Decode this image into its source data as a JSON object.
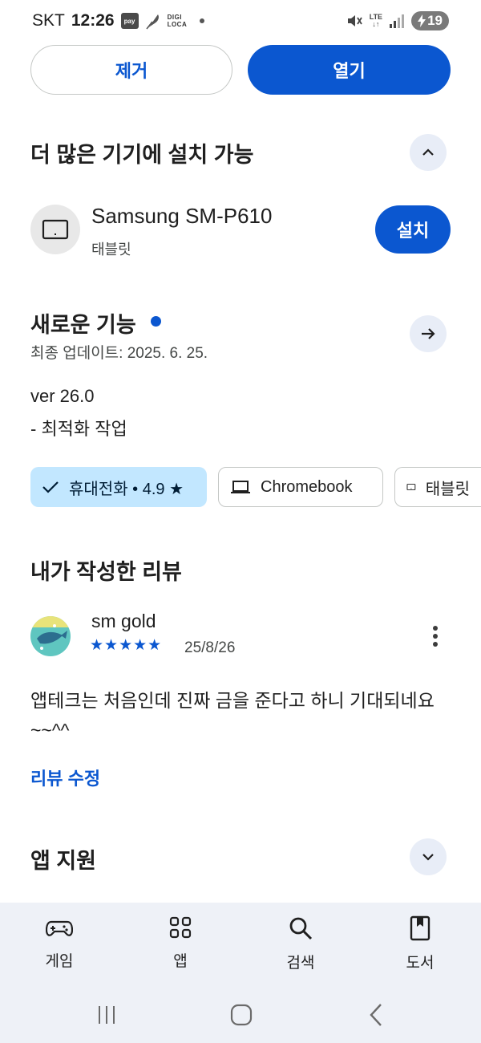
{
  "status_bar": {
    "carrier": "SKT",
    "time": "12:26",
    "pay_label": "pay",
    "digi_label": "DIGI LOCA",
    "lte_label": "LTE",
    "battery": "19"
  },
  "actions": {
    "remove_label": "제거",
    "open_label": "열기"
  },
  "more_devices": {
    "title": "더 많은 기기에 설치 가능",
    "device_name": "Samsung SM-P610",
    "device_type": "태블릿",
    "install_label": "설치"
  },
  "whats_new": {
    "title": "새로운 기능",
    "updated": "최종 업데이트: 2025. 6. 25.",
    "version": "ver 26.0",
    "changes": "- 최적화 작업"
  },
  "device_chips": [
    {
      "label": "휴대전화 • 4.9 ★",
      "selected": true
    },
    {
      "label": "Chromebook",
      "selected": false
    },
    {
      "label": "태블릿",
      "selected": false
    }
  ],
  "my_review": {
    "title": "내가 작성한 리뷰",
    "reviewer": "sm gold",
    "rating": 5,
    "stars_text": "★★★★★",
    "date": "25/8/26",
    "text": "앱테크는 처음인데 진짜 금을 준다고 하니 기대되네요~~^^",
    "edit_label": "리뷰 수정"
  },
  "app_support": {
    "title": "앱 지원"
  },
  "bottom_nav": [
    {
      "label": "게임",
      "icon": "gamepad-icon"
    },
    {
      "label": "앱",
      "icon": "apps-grid-icon"
    },
    {
      "label": "검색",
      "icon": "search-icon"
    },
    {
      "label": "도서",
      "icon": "book-icon"
    }
  ],
  "colors": {
    "accent": "#0b57d0",
    "chip_selected_bg": "#c2e7ff",
    "round_button_bg": "#e8edf7",
    "nav_bg": "#eef1f7"
  }
}
